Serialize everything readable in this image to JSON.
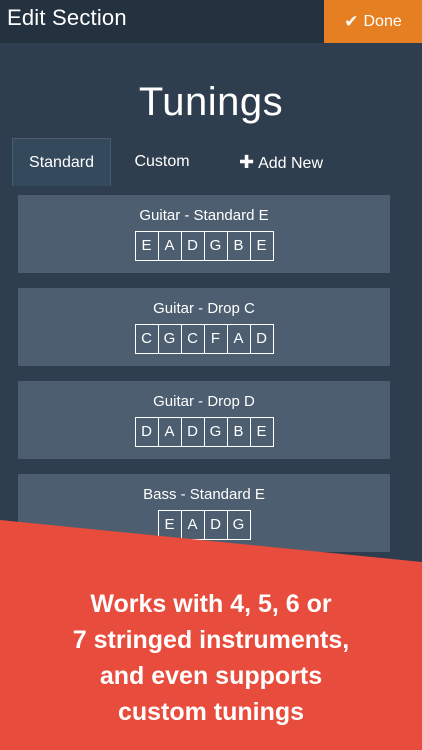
{
  "header": {
    "title": "Edit Section",
    "done_label": "Done"
  },
  "page": {
    "title": "Tunings"
  },
  "tabs": {
    "standard": "Standard",
    "custom": "Custom",
    "add_new": "Add New"
  },
  "tunings": [
    {
      "name": "Guitar - Standard E",
      "notes": [
        "E",
        "A",
        "D",
        "G",
        "B",
        "E"
      ]
    },
    {
      "name": "Guitar - Drop C",
      "notes": [
        "C",
        "G",
        "C",
        "F",
        "A",
        "D"
      ]
    },
    {
      "name": "Guitar - Drop D",
      "notes": [
        "D",
        "A",
        "D",
        "G",
        "B",
        "E"
      ]
    },
    {
      "name": "Bass - Standard E",
      "notes": [
        "E",
        "A",
        "D",
        "G"
      ]
    }
  ],
  "promo": {
    "line1": "Works with 4, 5, 6 or",
    "line2": "7 stringed instruments,",
    "line3": "and even supports",
    "line4": "custom tunings"
  },
  "colors": {
    "background": "#2e3e4f",
    "header": "#243240",
    "accent": "#e67e22",
    "card": "#4c5e6f",
    "promo": "#e74c3c"
  },
  "icons": {
    "done": "check-icon",
    "add": "plus-icon"
  }
}
